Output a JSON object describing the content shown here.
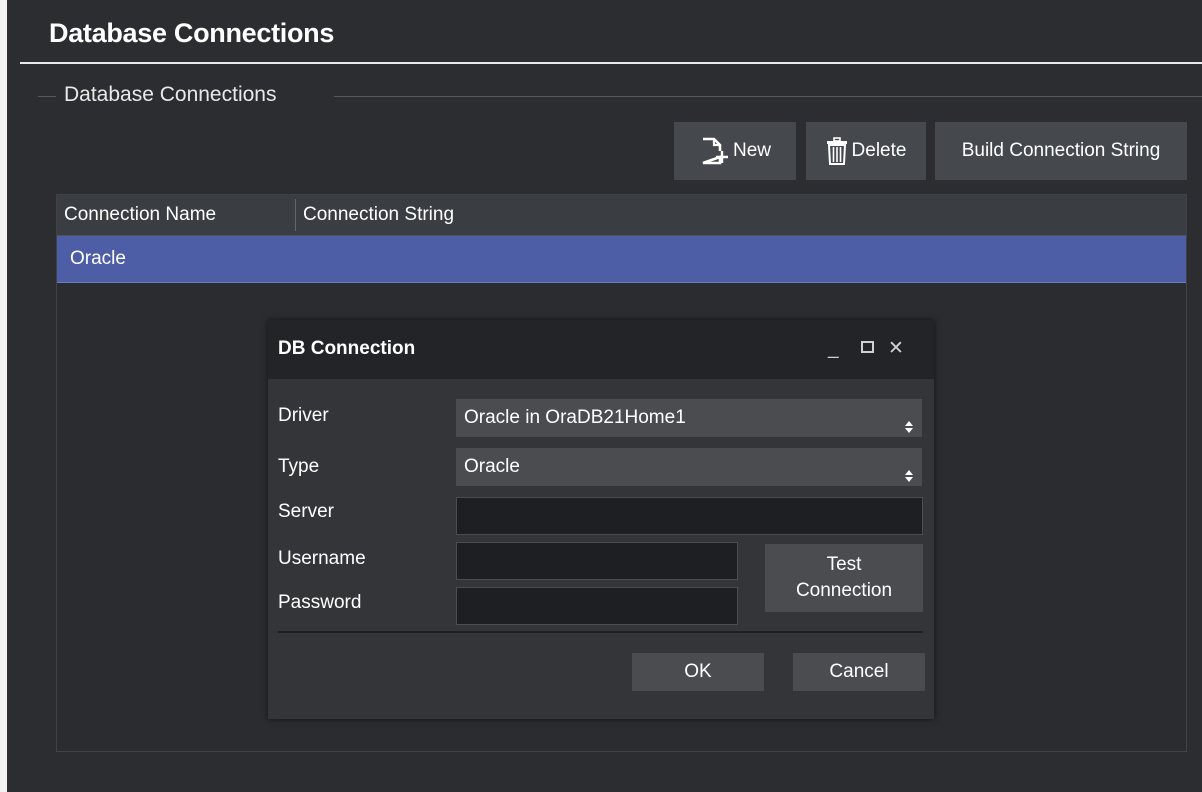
{
  "page": {
    "title": "Database Connections"
  },
  "group": {
    "title": "Database Connections"
  },
  "toolbar": {
    "new_label": "New",
    "delete_label": "Delete",
    "build_label": "Build Connection String"
  },
  "table": {
    "columns": [
      "Connection Name",
      "Connection String"
    ],
    "rows": [
      {
        "name": "Oracle",
        "connection_string": "",
        "selected": true
      }
    ]
  },
  "dialog": {
    "title": "DB Connection",
    "controls": {
      "minimize": "_",
      "close": "✕"
    },
    "labels": {
      "driver": "Driver",
      "type": "Type",
      "server": "Server",
      "username": "Username",
      "password": "Password"
    },
    "driver_value": "Oracle in OraDB21Home1",
    "type_value": "Oracle",
    "server_value": "",
    "username_value": "",
    "password_value": "",
    "test_button": "Test\nConnection",
    "ok_label": "OK",
    "cancel_label": "Cancel"
  },
  "icons": {
    "new": "new-document-icon",
    "delete": "trash-icon",
    "select_arrow": "up-down-arrow-icon",
    "minimize": "minimize-icon",
    "maximize": "maximize-icon",
    "close": "close-icon"
  },
  "colors": {
    "background": "#2b2d30",
    "selection": "#4e5ea6",
    "button": "#45484c"
  }
}
